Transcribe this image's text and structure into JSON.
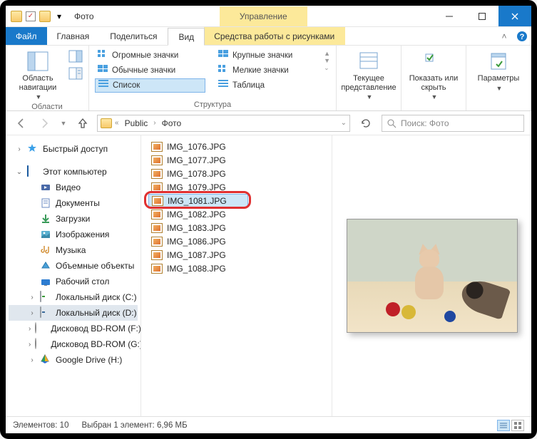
{
  "titlebar": {
    "title": "Фото",
    "context_tab": "Управление"
  },
  "menu": {
    "file": "Файл",
    "tabs": [
      "Главная",
      "Поделиться",
      "Вид"
    ],
    "context": "Средства работы с рисунками"
  },
  "ribbon": {
    "navpane": {
      "label": "Область навигации",
      "group": "Области"
    },
    "views": {
      "huge": "Огромные значки",
      "large": "Крупные значки",
      "normal": "Обычные значки",
      "small": "Мелкие значки",
      "list": "Список",
      "table": "Таблица",
      "group": "Структура"
    },
    "current": "Текущее представление",
    "showhide": "Показать или скрыть",
    "options": "Параметры"
  },
  "address": {
    "root": "Public",
    "folder": "Фото"
  },
  "search": {
    "placeholder": "Поиск: Фото"
  },
  "tree": {
    "quick": "Быстрый доступ",
    "pc": "Этот компьютер",
    "items": [
      "Видео",
      "Документы",
      "Загрузки",
      "Изображения",
      "Музыка",
      "Объемные объекты",
      "Рабочий стол",
      "Локальный диск (C:)",
      "Локальный диск (D:)",
      "Дисковод BD-ROM (F:)",
      "Дисковод BD-ROM (G:)",
      "Google Drive (H:)"
    ],
    "selectedIndex": 8
  },
  "files": {
    "items": [
      "IMG_1076.JPG",
      "IMG_1077.JPG",
      "IMG_1078.JPG",
      "IMG_1079.JPG",
      "IMG_1081.JPG",
      "IMG_1082.JPG",
      "IMG_1083.JPG",
      "IMG_1086.JPG",
      "IMG_1087.JPG",
      "IMG_1088.JPG"
    ],
    "selectedIndex": 4
  },
  "status": {
    "count": "Элементов: 10",
    "selection": "Выбран 1 элемент: 6,96 МБ"
  }
}
